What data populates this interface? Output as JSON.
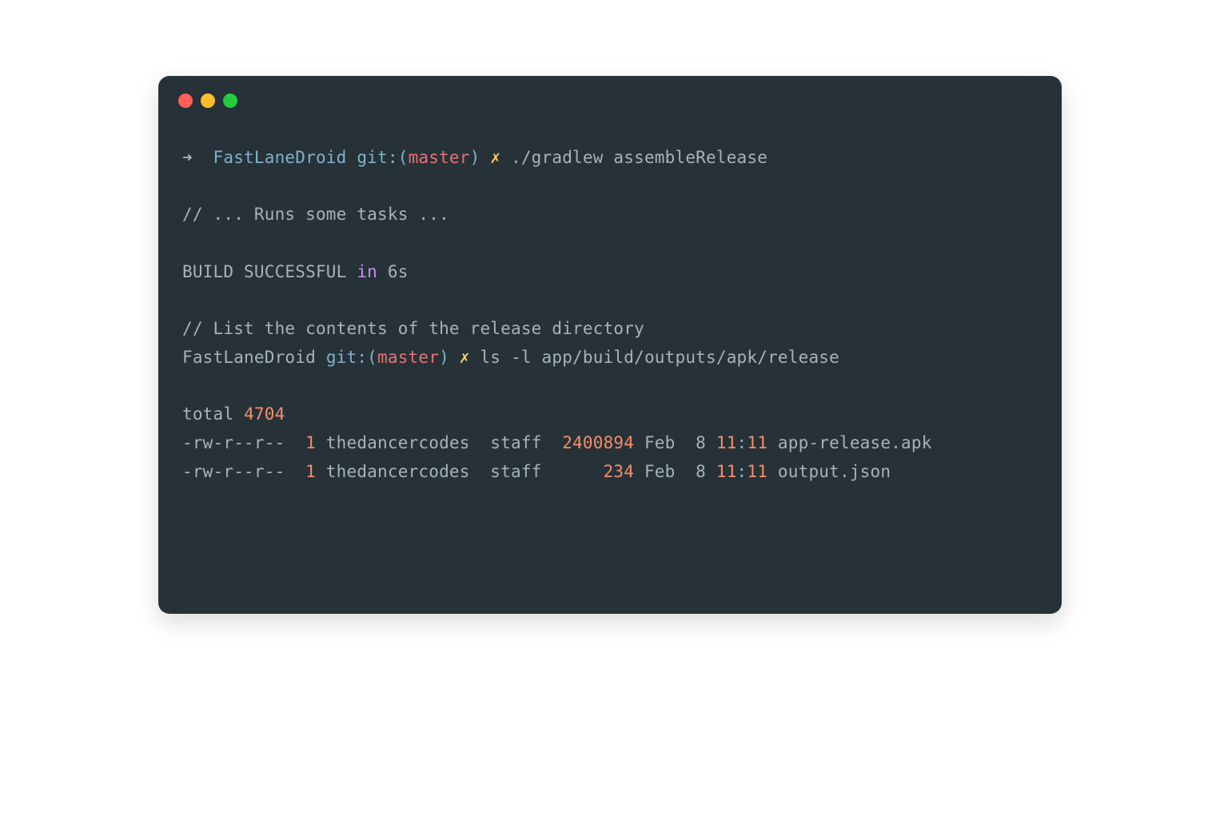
{
  "prompt1": {
    "arrow": "➜  ",
    "dir": "FastLaneDroid ",
    "git_label": "git:(",
    "branch": "master",
    "git_close": ") ",
    "dirty": "✗",
    "command": " ./gradlew assembleRelease"
  },
  "comment1": "// ... Runs some tasks ...",
  "build": {
    "text": "BUILD SUCCESSFUL ",
    "in": "in",
    "duration": " 6s"
  },
  "comment2": "// List the contents of the release directory",
  "prompt2": {
    "dir": "FastLaneDroid ",
    "git_label": "git:(",
    "branch": "master",
    "git_close": ") ",
    "dirty": "✗",
    "command": " ls -l app/build/outputs/apk/release"
  },
  "ls": {
    "total_label": "total ",
    "total_value": "4704",
    "rows": [
      {
        "perms": "-rw-r--r--  ",
        "links": "1",
        "owner": " thedancercodes  staff  ",
        "size": "2400894",
        "date": " Feb  8 ",
        "hour": "11",
        "colon": ":",
        "minute": "11",
        "name": " app-release.apk"
      },
      {
        "perms": "-rw-r--r--  ",
        "links": "1",
        "owner": " thedancercodes  staff      ",
        "size": "234",
        "date": " Feb  8 ",
        "hour": "11",
        "colon": ":",
        "minute": "11",
        "name": " output.json"
      }
    ]
  }
}
